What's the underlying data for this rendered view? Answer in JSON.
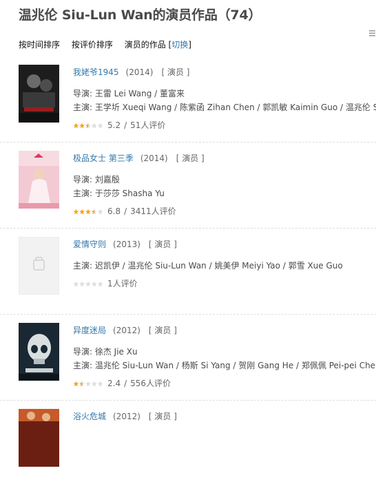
{
  "page": {
    "title": "温兆伦 Siu-Lun Wan的演员作品（74）"
  },
  "sort": {
    "by_time": "按时间排序",
    "by_rating": "按评价排序",
    "actor_works": "演员的作品",
    "switch": "切换"
  },
  "colors": {
    "link": "#3377aa",
    "star": "#f5a623",
    "star_empty": "#dddddd"
  },
  "items": [
    {
      "title": "我姥爷1945",
      "year": "(2014)",
      "role": "[ 演员 ]",
      "credits": [
        "导演: 王雷 Lei Wang / 董富来",
        "主演: 王学圻 Xueqi Wang / 陈紫函 Zihan Chen / 郭凯敏 Kaimin Guo / 温兆伦 Siu-L..."
      ],
      "stars": 2.5,
      "score": "5.2",
      "sep": "/",
      "votes": "51人评价",
      "poster": "dark"
    },
    {
      "title": "极品女士 第三季",
      "year": "(2014)",
      "role": "[ 演员 ]",
      "credits": [
        "导演: 刘嘉殷",
        "主演: 于莎莎 Shasha Yu"
      ],
      "stars": 3.5,
      "score": "6.8",
      "sep": "/",
      "votes": "3411人评价",
      "poster": "pink"
    },
    {
      "title": "爱情守则",
      "year": "(2013)",
      "role": "[ 演员 ]",
      "credits": [
        "主演: 迟凯伊 / 温兆伦 Siu-Lun Wan / 姚美伊 Meiyi Yao / 郭雪 Xue Guo"
      ],
      "stars": 0,
      "score": "",
      "sep": "",
      "votes": "1人评价",
      "poster": "placeholder"
    },
    {
      "title": "异度迷局",
      "year": "(2012)",
      "role": "[ 演员 ]",
      "credits": [
        "导演: 徐杰 Jie Xu",
        "主演: 温兆伦 Siu-Lun Wan / 杨斯 Si Yang / 贺刚 Gang He / 郑佩佩 Pei-pei Cheng"
      ],
      "stars": 1.5,
      "score": "2.4",
      "sep": "/",
      "votes": "556人评价",
      "poster": "skull"
    },
    {
      "title": "浴火危城",
      "year": "(2012)",
      "role": "[ 演员 ]",
      "credits": [],
      "stars": 0,
      "score": "",
      "sep": "",
      "votes": "",
      "poster": "fire"
    }
  ]
}
